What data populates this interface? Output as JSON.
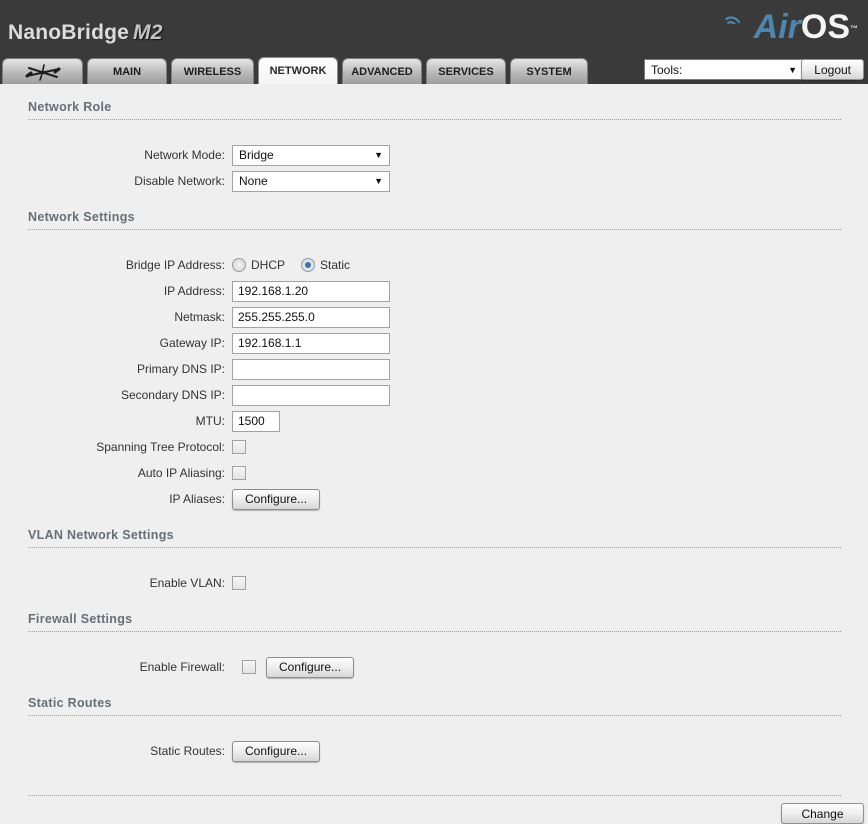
{
  "header": {
    "product_name": "NanoBridge",
    "product_model": "M2",
    "logo_air": "Air",
    "logo_os": "OS",
    "logo_tm": "TM",
    "tools_label": "Tools:",
    "logout_label": "Logout"
  },
  "tabs": {
    "main": "MAIN",
    "wireless": "WIRELESS",
    "network": "NETWORK",
    "advanced": "ADVANCED",
    "services": "SERVICES",
    "system": "SYSTEM",
    "active_tab": "NETWORK"
  },
  "network_role": {
    "title": "Network Role",
    "network_mode": {
      "label": "Network Mode:",
      "value": "Bridge"
    },
    "disable_network": {
      "label": "Disable Network:",
      "value": "None"
    }
  },
  "network_settings": {
    "title": "Network Settings",
    "bridge_ip": {
      "label": "Bridge IP Address:",
      "option_dhcp": "DHCP",
      "option_static": "Static",
      "selected": "Static"
    },
    "ip_address": {
      "label": "IP Address:",
      "value": "192.168.1.20"
    },
    "netmask": {
      "label": "Netmask:",
      "value": "255.255.255.0"
    },
    "gateway": {
      "label": "Gateway IP:",
      "value": "192.168.1.1"
    },
    "primary_dns": {
      "label": "Primary DNS IP:",
      "value": ""
    },
    "secondary_dns": {
      "label": "Secondary DNS IP:",
      "value": ""
    },
    "mtu": {
      "label": "MTU:",
      "value": "1500"
    },
    "stp": {
      "label": "Spanning Tree Protocol:",
      "checked": false
    },
    "auto_ip_aliasing": {
      "label": "Auto IP Aliasing:",
      "checked": false
    },
    "ip_aliases": {
      "label": "IP Aliases:",
      "button_label": "Configure..."
    }
  },
  "vlan_settings": {
    "title": "VLAN Network Settings",
    "enable_vlan": {
      "label": "Enable VLAN:",
      "checked": false
    }
  },
  "firewall_settings": {
    "title": "Firewall Settings",
    "enable_firewall": {
      "label": "Enable Firewall:",
      "checked": false,
      "button_label": "Configure..."
    }
  },
  "static_routes": {
    "title": "Static Routes",
    "configure": {
      "label": "Static Routes:",
      "button_label": "Configure..."
    }
  },
  "footer": {
    "change_label": "Change"
  },
  "colors": {
    "header_bg": "#3a3a3a",
    "content_bg": "#efefef",
    "accent_blue": "#4f86ae",
    "section_title": "#667077",
    "radio_selected": "#3c74a6"
  }
}
